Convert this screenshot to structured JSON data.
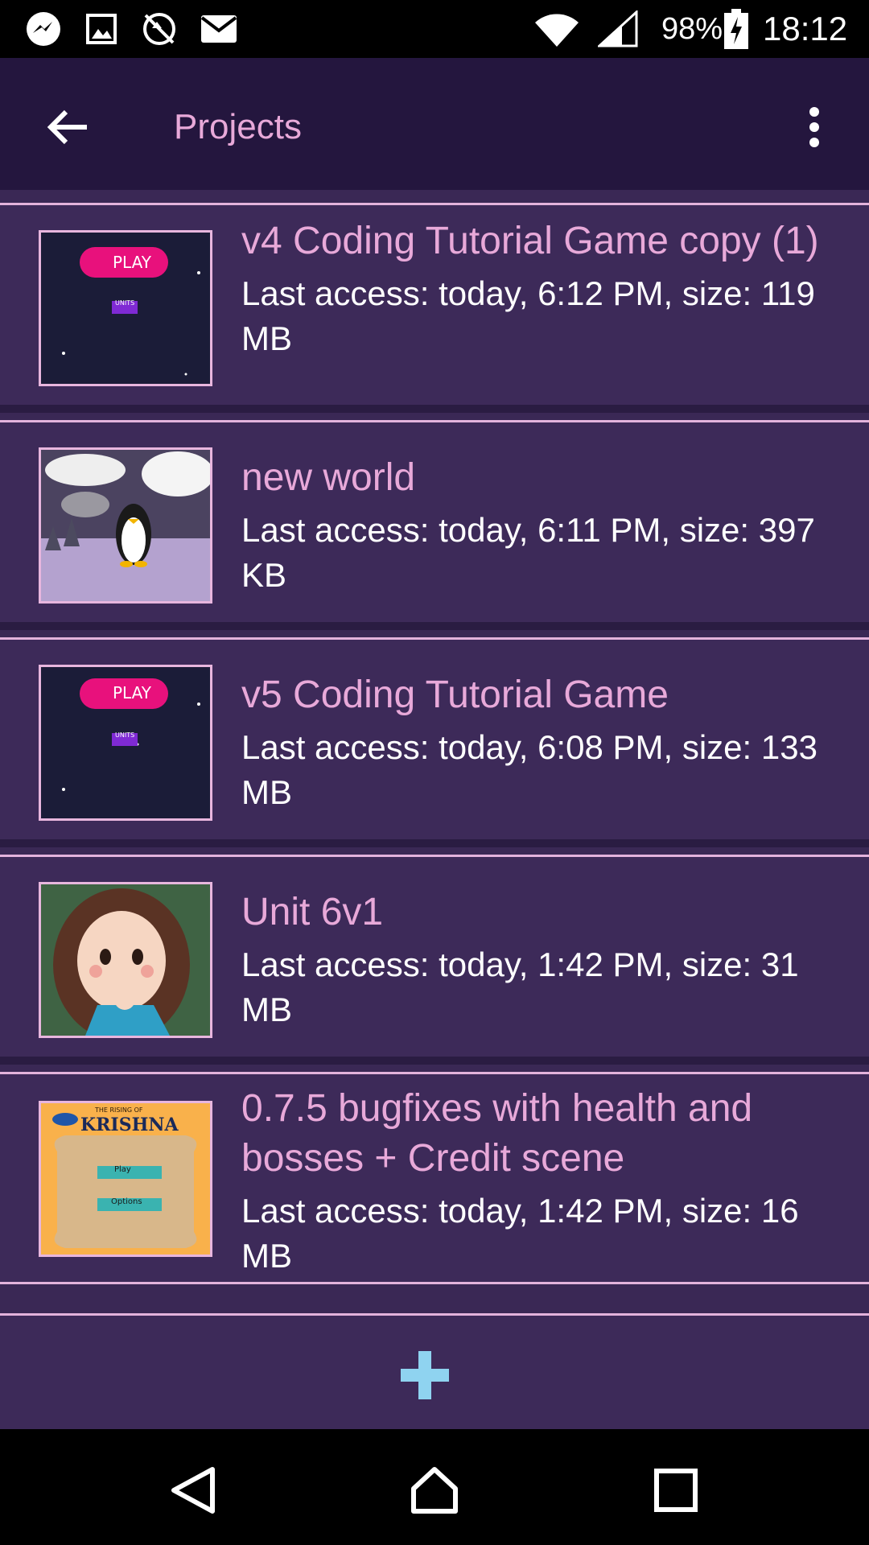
{
  "status_bar": {
    "battery": "98%",
    "time": "18:12",
    "icons": [
      "messenger-icon",
      "image-icon",
      "no-sync-icon",
      "mail-icon",
      "wifi-icon",
      "signal-icon",
      "battery-charging-icon"
    ]
  },
  "app_bar": {
    "title": "Projects",
    "back_icon": "arrow-back-icon",
    "menu_icon": "more-vert-icon"
  },
  "projects": [
    {
      "title": "v4 Coding Tutorial Game copy (1)",
      "access": "Last access: today, 6:12 PM, size: 119 MB",
      "thumb": "space-play-menu"
    },
    {
      "title": "new world",
      "access": "Last access: today, 6:11 PM, size: 397 KB",
      "thumb": "penguin-clouds"
    },
    {
      "title": "v5 Coding Tutorial Game",
      "access": "Last access: today, 6:08 PM, size: 133 MB",
      "thumb": "space-play-menu"
    },
    {
      "title": "Unit 6v1",
      "access": "Last access: today, 1:42 PM, size: 31 MB",
      "thumb": "girl-character"
    },
    {
      "title": "0.7.5  bugfixes with health and bosses + Credit scene",
      "access": "Last access: today, 1:42 PM, size: 16 MB",
      "thumb": "krishna-scroll"
    }
  ],
  "thumb_text": {
    "play": "PLAY",
    "units": "UNITS",
    "krishna_small": "THE RISING OF",
    "krishna": "KRISHNA",
    "play_btn": "Play",
    "options_btn": "Options"
  },
  "add_button": {
    "icon": "plus-icon"
  },
  "nav_bar": {
    "icons": [
      "back-triangle-icon",
      "home-icon",
      "recents-icon"
    ]
  },
  "colors": {
    "background": "#3a2855",
    "app_bar": "#24163e",
    "accent_text": "#e8a9d9",
    "plus": "#8fd3f0"
  }
}
